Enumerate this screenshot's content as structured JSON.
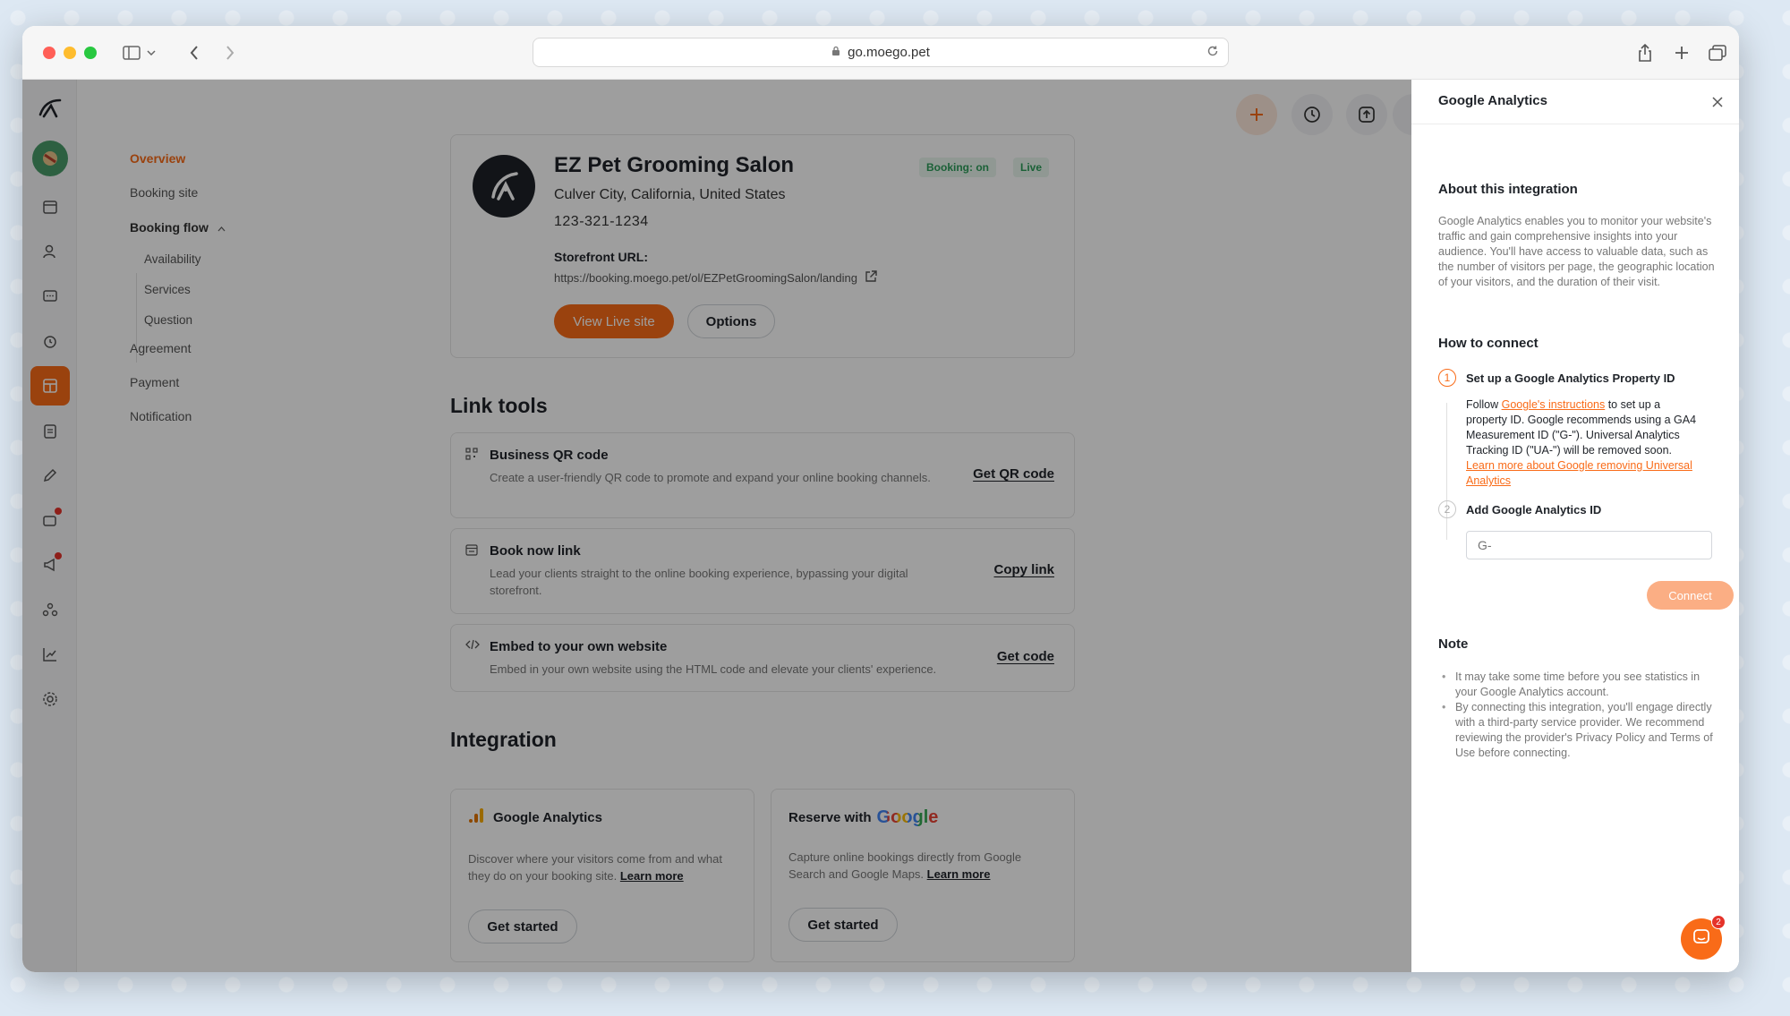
{
  "browser": {
    "url": "go.moego.pet"
  },
  "nav": {
    "overview": "Overview",
    "booking_site": "Booking site",
    "booking_flow": "Booking flow",
    "availability": "Availability",
    "services": "Services",
    "question": "Question",
    "agreement": "Agreement",
    "payment": "Payment",
    "notification": "Notification"
  },
  "business": {
    "name": "EZ Pet Grooming Salon",
    "location": "Culver City, California, United States",
    "phone": "123-321-1234",
    "storefront_label": "Storefront URL:",
    "storefront_url": "https://booking.moego.pet/ol/EZPetGroomingSalon/landing",
    "badge_booking": "Booking: on",
    "badge_live": "Live",
    "view_live_label": "View Live site",
    "options_label": "Options"
  },
  "link_tools": {
    "title": "Link tools",
    "items": [
      {
        "title": "Business QR code",
        "desc": "Create a user-friendly QR code to promote and expand your online booking channels.",
        "action": "Get QR code"
      },
      {
        "title": "Book now link",
        "desc": "Lead your clients straight to the online booking experience, bypassing your digital storefront.",
        "action": "Copy link"
      },
      {
        "title": "Embed to your own website",
        "desc": "Embed in your own website using the HTML code and elevate your clients' experience.",
        "action": "Get code"
      }
    ]
  },
  "integration": {
    "title": "Integration",
    "ga": {
      "title": "Google Analytics",
      "desc": "Discover where your visitors come from and what they do on your booking site.",
      "learn_more": "Learn more",
      "button": "Get started"
    },
    "rwg": {
      "title": "Reserve with",
      "google_word": "Google",
      "desc": "Capture online bookings directly from Google Search and Google Maps.",
      "learn_more": "Learn more",
      "button": "Get started"
    }
  },
  "drawer": {
    "title": "Google Analytics",
    "about_heading": "About this integration",
    "about_text": "Google Analytics enables you to monitor your website's traffic and gain comprehensive insights into your audience. You'll have access to valuable data, such as the number of visitors per page, the geographic location of your visitors, and the duration of their visit.",
    "how_heading": "How to connect",
    "step1_num": "1",
    "step1_title": "Set up a Google Analytics Property ID",
    "step1_pre": "Follow ",
    "step1_link1": "Google's instructions",
    "step1_mid": " to set up a property ID. Google recommends using a GA4 Measurement ID (\"G-\"). Universal Analytics Tracking ID (\"UA-\") will be removed soon. ",
    "step1_link2": "Learn more about Google removing Universal Analytics",
    "step2_num": "2",
    "step2_title": "Add Google Analytics ID",
    "input_placeholder": "G-",
    "connect_label": "Connect",
    "note_heading": "Note",
    "notes": [
      "It may take some time before you see statistics in your Google Analytics account.",
      "By connecting this integration, you'll engage directly with a third-party service provider. We recommend reviewing the provider's Privacy Policy and Terms of Use before connecting."
    ]
  },
  "chat": {
    "count": "2"
  },
  "colors": {
    "accent": "#f96b18",
    "accent_light": "#fbae84",
    "live_green": "#2d9d5a"
  }
}
